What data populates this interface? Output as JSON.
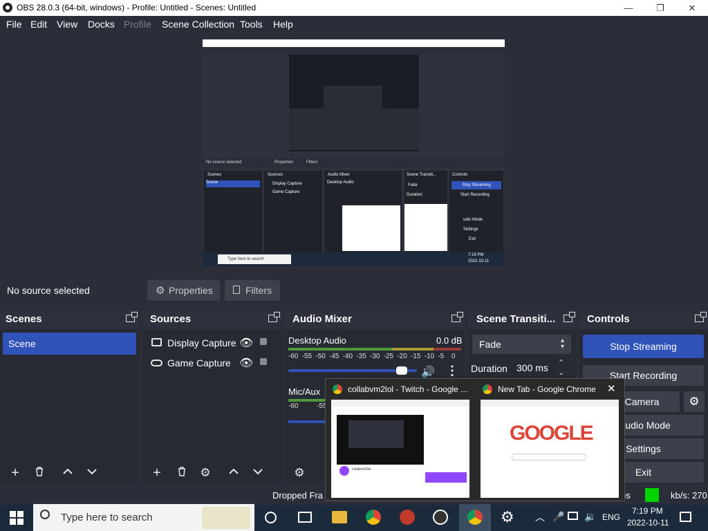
{
  "window": {
    "title": "OBS 28.0.3 (64-bit, windows) - Profile: Untitled - Scenes: Untitled",
    "minimize_glyph": "—",
    "maximize_glyph": "❐",
    "close_glyph": "✕"
  },
  "menu": {
    "file": "File",
    "edit": "Edit",
    "view": "View",
    "docks": "Docks",
    "profile": "Profile",
    "scene_collection": "Scene Collection",
    "tools": "Tools",
    "help": "Help"
  },
  "preview_inner": {
    "no_source": "No source selected",
    "properties": "Properties",
    "filters": "Filters",
    "scenes": "Scenes",
    "sources": "Sources",
    "audio_mixer": "Audio Mixer",
    "scene_transitions": "Scene Transiti...",
    "controls": "Controls",
    "scene": "Scene",
    "display_capture": "Display Capture",
    "game_capture": "Game Capture",
    "desktop_audio": "Desktop Audio",
    "fade": "Fade",
    "duration": "Duration",
    "stop_streaming": "Stop Streaming",
    "start_recording": "Start Recording",
    "studio_mode": "udio Mode",
    "settings": "Settings",
    "exit": "Exit",
    "search": "Type here to search",
    "time": "7:19 PM",
    "date": "2022-10-11"
  },
  "source_bar": {
    "status": "No source selected",
    "properties_label": "Properties",
    "filters_label": "Filters"
  },
  "scenes": {
    "title": "Scenes",
    "items": [
      "Scene"
    ]
  },
  "sources": {
    "title": "Sources",
    "items": [
      {
        "label": "Display Capture",
        "icon": "monitor-icon"
      },
      {
        "label": "Game Capture",
        "icon": "gamepad-icon"
      }
    ]
  },
  "mixer": {
    "title": "Audio Mixer",
    "channel1": {
      "name": "Desktop Audio",
      "level": "0.0 dB"
    },
    "channel2": {
      "name": "Mic/Aux"
    },
    "scale": [
      "-60",
      "-55",
      "-50",
      "-45",
      "-40",
      "-35",
      "-30",
      "-25",
      "-20",
      "-15",
      "-10",
      "-5",
      "0"
    ],
    "scale2": [
      "-60",
      "-55"
    ],
    "volume": 0.88
  },
  "transitions": {
    "title": "Scene Transiti...",
    "selected": "Fade",
    "duration_label": "Duration",
    "duration_value": "300 ms"
  },
  "controls": {
    "title": "Controls",
    "stop_streaming": "Stop Streaming",
    "start_recording": "Start Recording",
    "virtual_camera": "rtual Camera",
    "studio_mode": "Studio Mode",
    "settings": "Settings",
    "exit": "Exit"
  },
  "statusbar": {
    "dropped": "Dropped Fra",
    "ps": "ps",
    "kbs": "kb/s: 270"
  },
  "taskbar": {
    "search_placeholder": "Type here to search",
    "language": "ENG",
    "time": "7:19 PM",
    "date": "2022-10-11"
  },
  "popup": {
    "tab1": "collabvm2lol - Twitch - Google ...",
    "tab2": "New Tab - Google Chrome",
    "twitch_name": "collabvm2lol",
    "google_word": "GOOGLE"
  },
  "colors": {
    "accent": "#2f53b9",
    "stream_indicator": "#00d400",
    "meter_green": "#4e9a3b",
    "meter_yellow": "#a89d33",
    "meter_red": "#9b3a3a"
  }
}
